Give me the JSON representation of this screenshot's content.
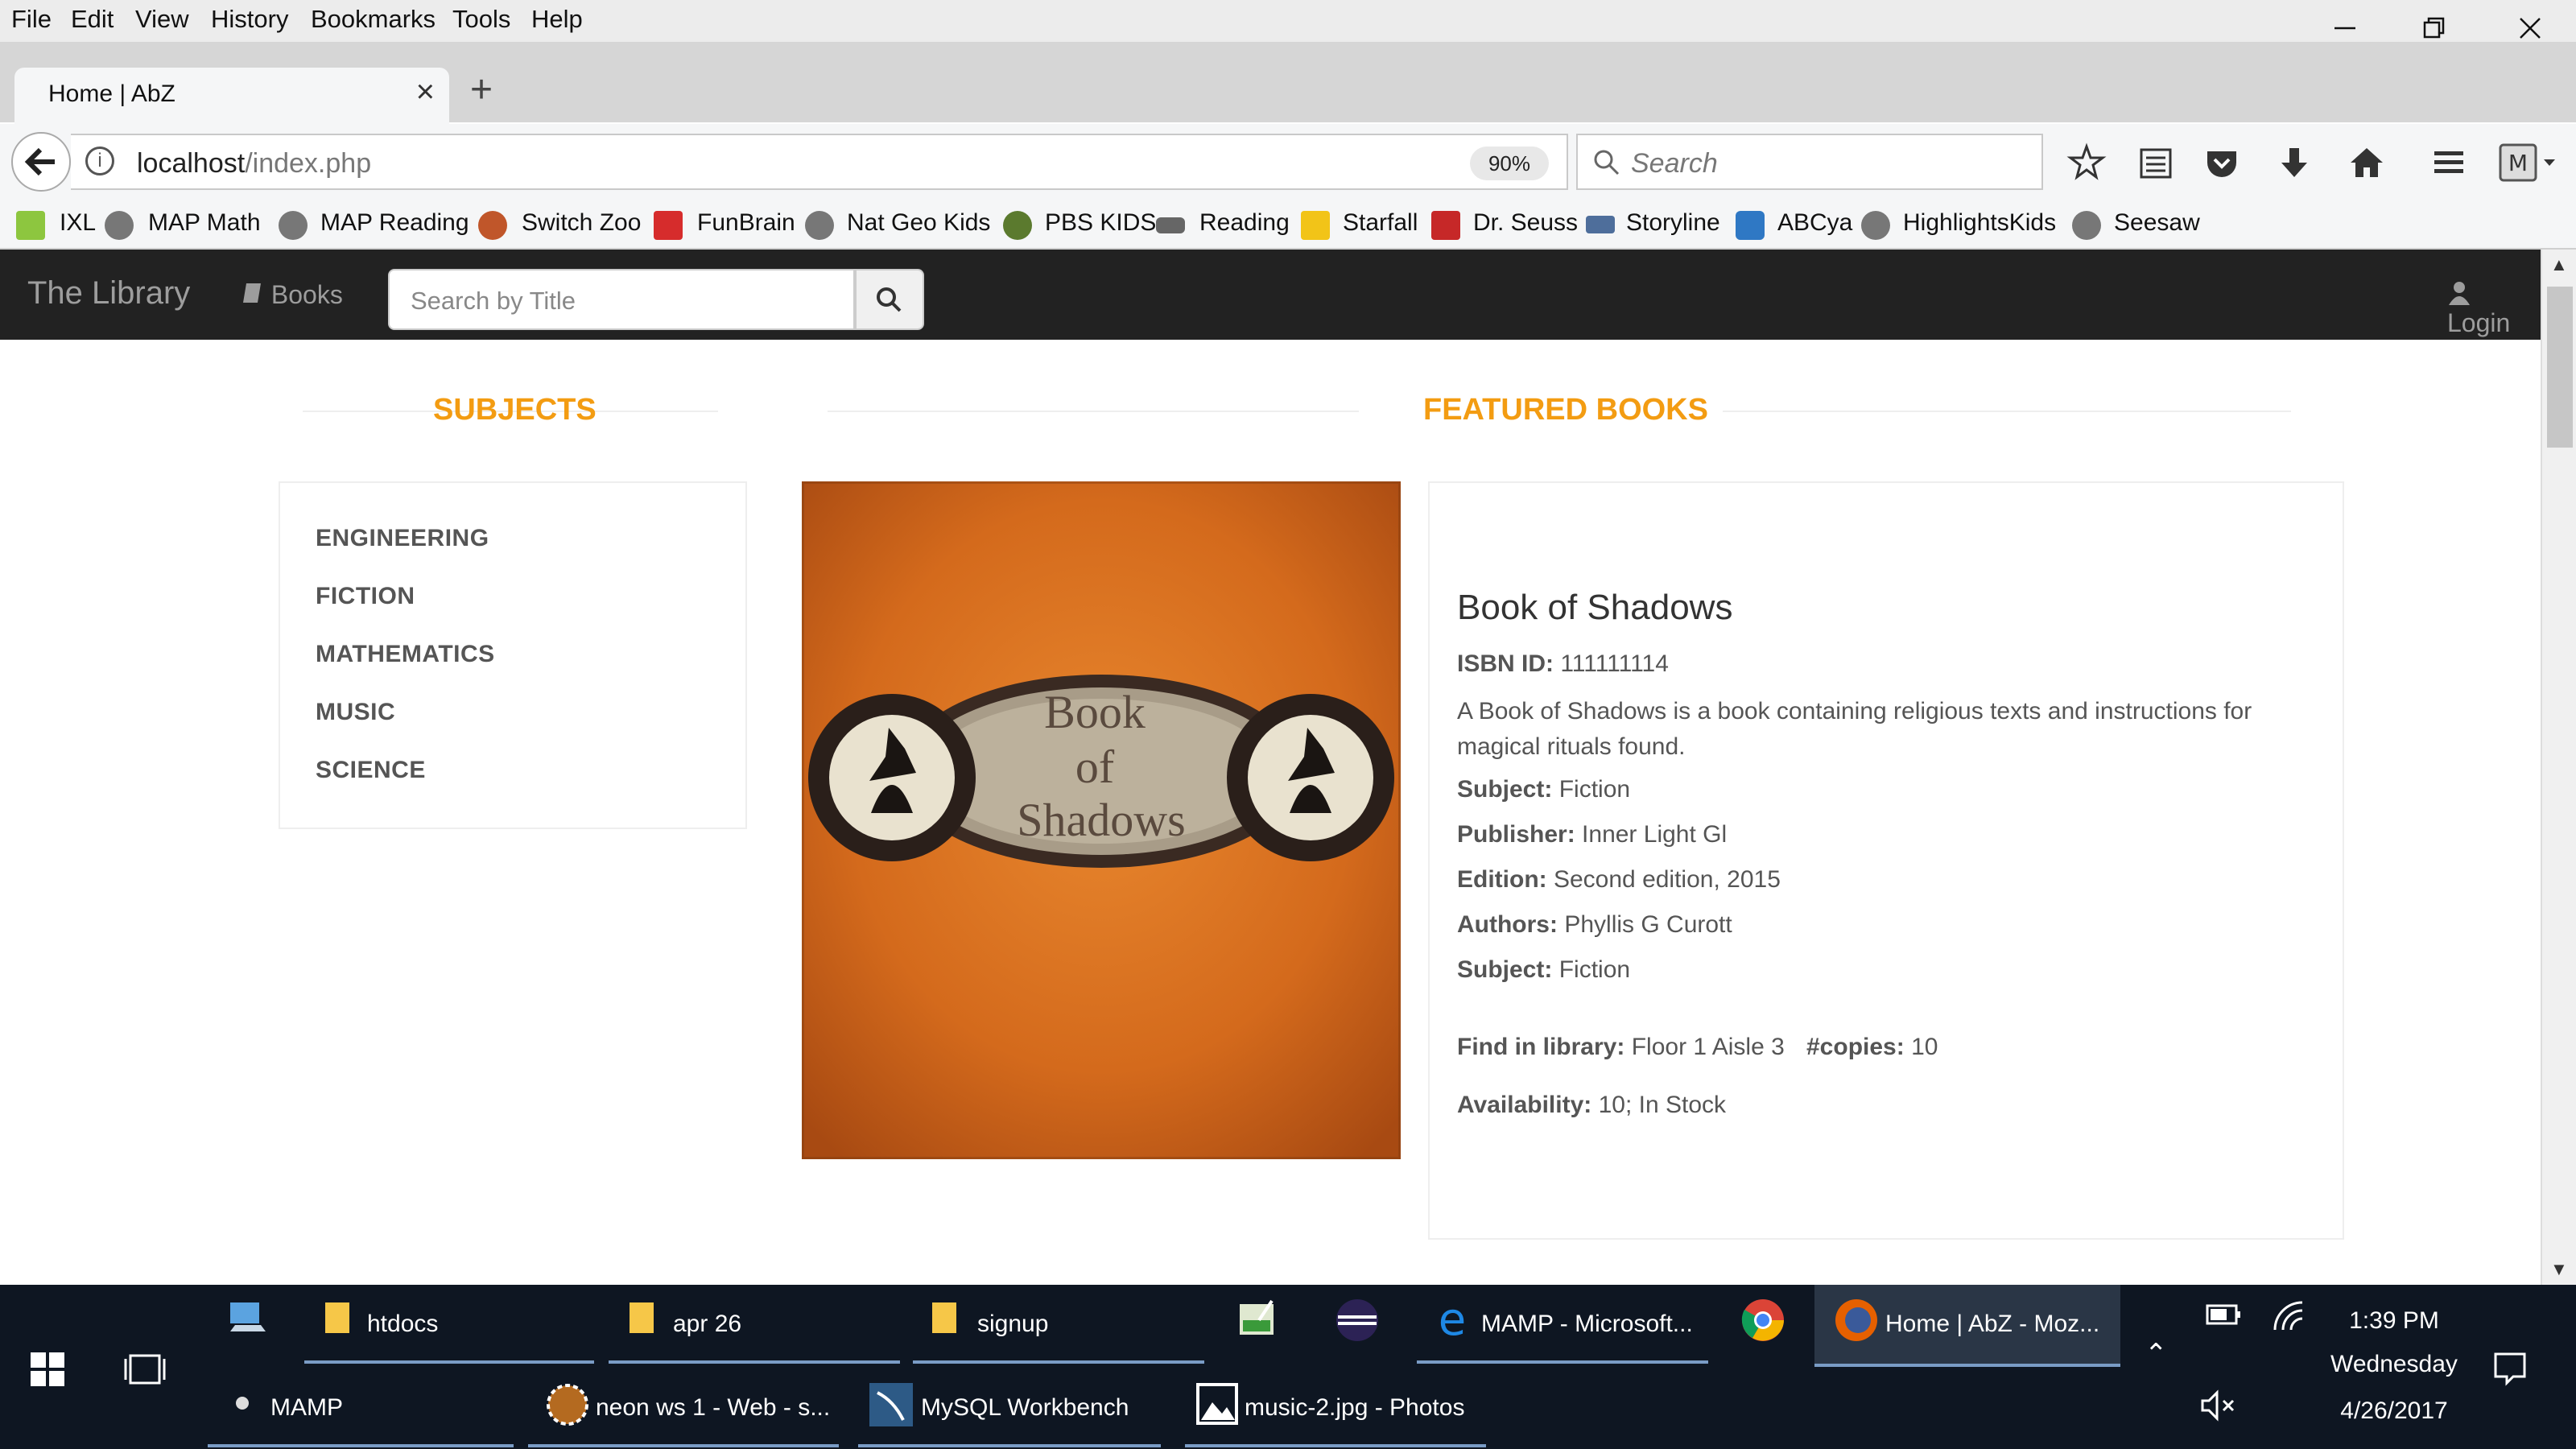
{
  "browser": {
    "menu": [
      "File",
      "Edit",
      "View",
      "History",
      "Bookmarks",
      "Tools",
      "Help"
    ],
    "tab_title": "Home | AbZ",
    "url_host": "localhost",
    "url_path": "/index.php",
    "zoom": "90%",
    "search_placeholder": "Search",
    "bookmarks": [
      "IXL",
      "MAP Math",
      "MAP Reading",
      "Switch Zoo",
      "FunBrain",
      "Nat Geo Kids",
      "PBS KIDS",
      "Reading",
      "Starfall",
      "Dr. Seuss",
      "Storyline",
      "ABCya",
      "HighlightsKids",
      "Seesaw"
    ]
  },
  "site": {
    "brand": "The Library",
    "nav_books": "Books",
    "search_placeholder": "Search by Title",
    "login": "Login",
    "subjects_title": "SUBJECTS",
    "featured_title": "FEATURED BOOKS",
    "subjects": [
      "ENGINEERING",
      "FICTION",
      "MATHEMATICS",
      "MUSIC",
      "SCIENCE"
    ]
  },
  "book": {
    "cover_line1": "Book",
    "cover_line2": "of",
    "cover_line3": "Shadows",
    "title": "Book of Shadows",
    "isbn_label": "ISBN ID:",
    "isbn": "111111114",
    "description": "A Book of Shadows is a book containing religious texts and instructions for magical rituals found.",
    "subject_label": "Subject:",
    "subject": "Fiction",
    "publisher_label": "Publisher:",
    "publisher": "Inner Light Gl",
    "edition_label": "Edition:",
    "edition": "Second edition, 2015",
    "authors_label": "Authors:",
    "authors": "Phyllis G Curott",
    "subject2_label": "Subject:",
    "subject2": "Fiction",
    "find_label": "Find in library:",
    "find": "Floor 1 Aisle 3",
    "copies_label": "#copies:",
    "copies": "10",
    "availability_label": "Availability:",
    "availability": "10; In Stock"
  },
  "taskbar": {
    "row1": [
      "htdocs",
      "apr 26",
      "signup",
      "MAMP - Microsoft...",
      "Home | AbZ - Moz..."
    ],
    "row2": [
      "MAMP",
      "neon ws 1 - Web - s...",
      "MySQL Workbench",
      "music-2.jpg - Photos"
    ],
    "time": "1:39 PM",
    "day": "Wednesday",
    "date": "4/26/2017"
  }
}
